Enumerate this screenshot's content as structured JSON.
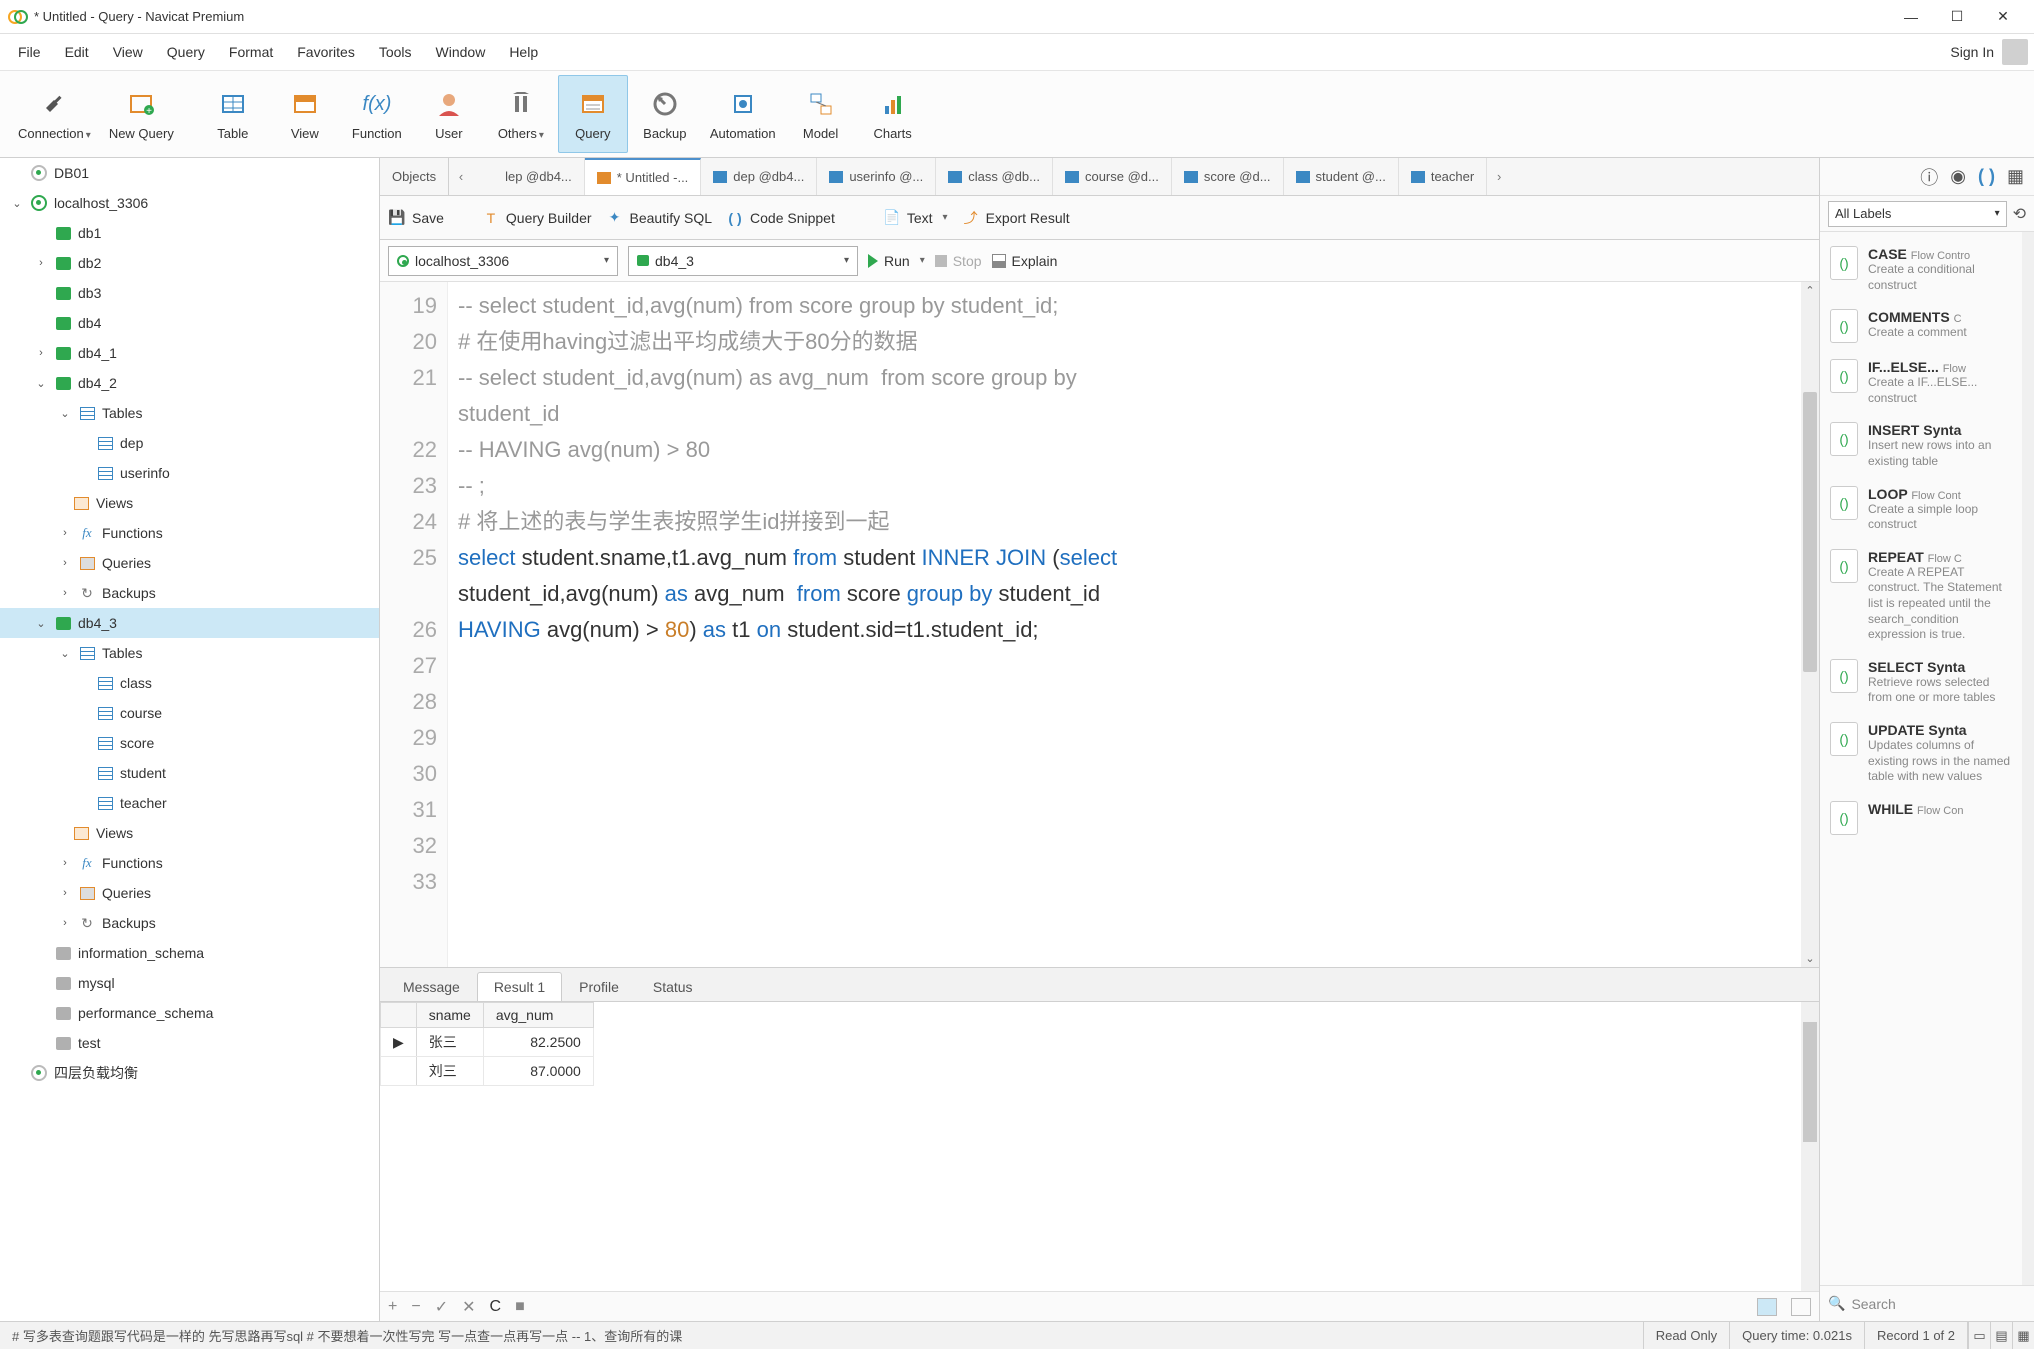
{
  "window": {
    "title": "* Untitled - Query - Navicat Premium"
  },
  "menu": [
    "File",
    "Edit",
    "View",
    "Query",
    "Format",
    "Favorites",
    "Tools",
    "Window",
    "Help"
  ],
  "signin": "Sign In",
  "ribbon": [
    {
      "label": "Connection",
      "dropdown": true
    },
    {
      "label": "New Query"
    },
    {
      "label": "Table"
    },
    {
      "label": "View"
    },
    {
      "label": "Function"
    },
    {
      "label": "User"
    },
    {
      "label": "Others",
      "dropdown": true
    },
    {
      "label": "Query",
      "active": true
    },
    {
      "label": "Backup"
    },
    {
      "label": "Automation"
    },
    {
      "label": "Model"
    },
    {
      "label": "Charts"
    }
  ],
  "tree": {
    "db01": "DB01",
    "localhost": "localhost_3306",
    "dbs": [
      "db1",
      "db2",
      "db3",
      "db4",
      "db4_1"
    ],
    "db4_2": {
      "name": "db4_2",
      "tables_label": "Tables",
      "tables": [
        "dep",
        "userinfo"
      ],
      "views": "Views",
      "functions": "Functions",
      "queries": "Queries",
      "backups": "Backups"
    },
    "db4_3": {
      "name": "db4_3",
      "tables_label": "Tables",
      "tables": [
        "class",
        "course",
        "score",
        "student",
        "teacher"
      ],
      "views": "Views",
      "functions": "Functions",
      "queries": "Queries",
      "backups": "Backups"
    },
    "sysdbs": [
      "information_schema",
      "mysql",
      "performance_schema",
      "test"
    ],
    "balance": "四层负载均衡"
  },
  "obj_tabs": {
    "objects": "Objects",
    "tabs": [
      "lep @db4...",
      "* Untitled -...",
      "dep @db4...",
      "userinfo @...",
      "class @db...",
      "course @d...",
      "score @d...",
      "student @...",
      "teacher"
    ]
  },
  "qtoolbar": {
    "save": "Save",
    "query_builder": "Query Builder",
    "beautify": "Beautify SQL",
    "snippet": "Code Snippet",
    "text": "Text",
    "export": "Export Result"
  },
  "conn": {
    "host": "localhost_3306",
    "db": "db4_3",
    "run": "Run",
    "stop": "Stop",
    "explain": "Explain"
  },
  "code_lines": {
    "l19": "-- select student_id,avg(num) from score group by student_id;",
    "l20": "# 在使用having过滤出平均成绩大于80分的数据",
    "l21a": "-- select student_id,avg(num) as avg_num  from score group by",
    "l21b": "student_id",
    "l22": "-- HAVING avg(num) > 80",
    "l23": "-- ;",
    "l24": "# 将上述的表与学生表按照学生id拼接到一起"
  },
  "gutter": [
    "19",
    "20",
    "21",
    "",
    "22",
    "23",
    "24",
    "25",
    "",
    "26",
    "27",
    "28",
    "29",
    "30",
    "31",
    "32",
    "33"
  ],
  "result_tabs": {
    "message": "Message",
    "result1": "Result 1",
    "profile": "Profile",
    "status": "Status"
  },
  "result": {
    "cols": [
      "sname",
      "avg_num"
    ],
    "rows": [
      {
        "sname": "张三",
        "avg": "82.2500"
      },
      {
        "sname": "刘三",
        "avg": "87.0000"
      }
    ]
  },
  "rp": {
    "labels": "All Labels",
    "snippets": [
      {
        "title": "CASE",
        "sub": "Flow Contro",
        "desc": "Create a conditional construct"
      },
      {
        "title": "COMMENTS",
        "sub": "C",
        "desc": "Create a comment"
      },
      {
        "title": "IF...ELSE...",
        "sub": "Flow",
        "desc": "Create a IF...ELSE... construct"
      },
      {
        "title": "INSERT Synta",
        "sub": "",
        "desc": "Insert new rows into an existing table"
      },
      {
        "title": "LOOP",
        "sub": "Flow Cont",
        "desc": "Create a simple loop construct"
      },
      {
        "title": "REPEAT",
        "sub": "Flow C",
        "desc": "Create A REPEAT construct. The Statement list is repeated until the search_condition expression is true."
      },
      {
        "title": "SELECT Synta",
        "sub": "",
        "desc": "Retrieve rows selected from one or more tables"
      },
      {
        "title": "UPDATE Synta",
        "sub": "",
        "desc": "Updates columns of existing rows in the named table with new values"
      },
      {
        "title": "WHILE",
        "sub": "Flow Con",
        "desc": ""
      }
    ],
    "search": "Search"
  },
  "status": {
    "msg": "# 写多表查询题跟写代码是一样的 先写思路再写sql # 不要想着一次性写完 写一点查一点再写一点 -- 1、查询所有的课",
    "readonly": "Read Only",
    "querytime": "Query time: 0.021s",
    "record": "Record 1 of 2"
  }
}
